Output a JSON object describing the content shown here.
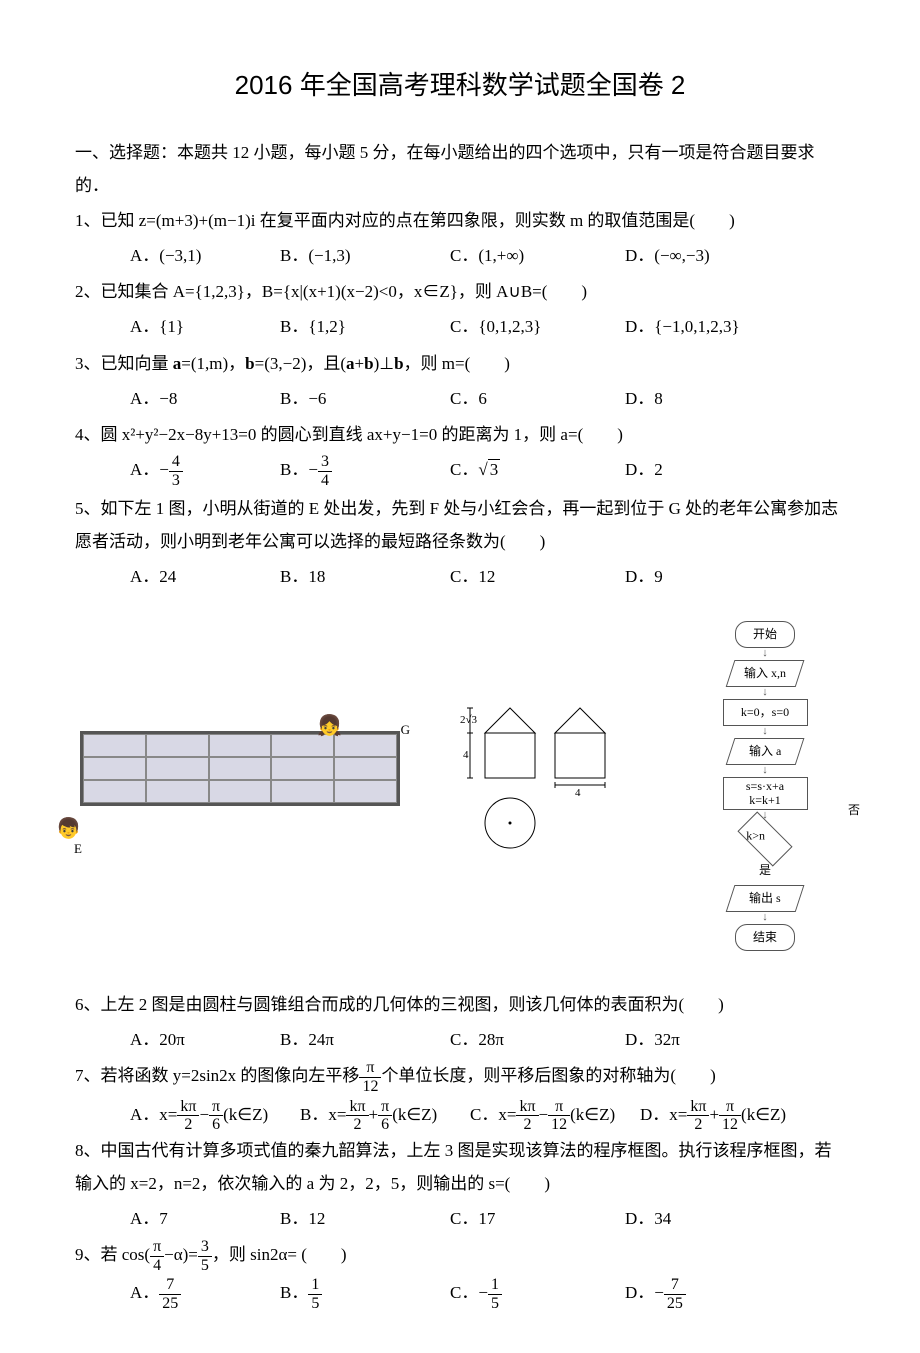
{
  "title": "2016 年全国高考理科数学试题全国卷 2",
  "section1": "一、选择题：本题共 12 小题，每小题 5 分，在每小题给出的四个选项中，只有一项是符合题目要求的．",
  "q1": {
    "text": "1、已知 z=(m+3)+(m−1)i 在复平面内对应的点在第四象限，则实数 m 的取值范围是(　　)",
    "a": "A．(−3,1)",
    "b": "B．(−1,3)",
    "c": "C．(1,+∞)",
    "d": "D．(−∞,−3)"
  },
  "q2": {
    "text": "2、已知集合 A={1,2,3}，B={x|(x+1)(x−2)<0，x∈Z}，则 A∪B=(　　)",
    "a": "A．{1}",
    "b": "B．{1,2}",
    "c": "C．{0,1,2,3}",
    "d": "D．{−1,0,1,2,3}"
  },
  "q3": {
    "text_pre": "3、已知向量 ",
    "a_vec": "a",
    "text_mid1": "=(1,m)，",
    "b_vec": "b",
    "text_mid2": "=(3,−2)，且(",
    "text_mid3": ")⊥",
    "text_end": "，则 m=(　　)",
    "a": "A．−8",
    "b": "B．−6",
    "c": "C．6",
    "d": "D．8"
  },
  "q4": {
    "text": "4、圆 x²+y²−2x−8y+13=0 的圆心到直线 ax+y−1=0 的距离为 1，则 a=(　　)",
    "a_pre": "A．−",
    "a_num": "4",
    "a_den": "3",
    "b_pre": "B．−",
    "b_num": "3",
    "b_den": "4",
    "c_pre": "C．",
    "c_val": "3",
    "d": "D．2"
  },
  "q5": {
    "text": "5、如下左 1 图，小明从街道的 E 处出发，先到 F 处与小红会合，再一起到位于 G 处的老年公寓参加志愿者活动，则小明到老年公寓可以选择的最短路径条数为(　　)",
    "a": "A．24",
    "b": "B．18",
    "c": "C．12",
    "d": "D．9"
  },
  "q6": {
    "text": "6、上左 2 图是由圆柱与圆锥组合而成的几何体的三视图，则该几何体的表面积为(　　)",
    "a": "A．20π",
    "b": "B．24π",
    "c": "C．28π",
    "d": "D．32π"
  },
  "q7": {
    "text_pre": "7、若将函数 y=2sin2x 的图像向左平移",
    "num": "π",
    "den": "12",
    "text_post": "个单位长度，则平移后图象的对称轴为(　　)",
    "a_pre": "A．x=",
    "a_n1": "kπ",
    "a_d1": "2",
    "a_mid": "−",
    "a_n2": "π",
    "a_d2": "6",
    "a_suf": "(k∈Z)",
    "b_pre": "B．x=",
    "b_mid": "+",
    "c_pre": "C．x=",
    "c_n2": "π",
    "c_d2": "12",
    "c_mid": "−",
    "d_pre": "D．x=",
    "d_mid": "+"
  },
  "q8": {
    "text": "8、中国古代有计算多项式值的秦九韶算法，上左 3 图是实现该算法的程序框图。执行该程序框图，若输入的 x=2，n=2，依次输入的 a 为 2，2，5，则输出的 s=(　　)",
    "a": "A．7",
    "b": "B．12",
    "c": "C．17",
    "d": "D．34"
  },
  "q9": {
    "text_pre": "9、若 cos(",
    "n1": "π",
    "d1": "4",
    "text_mid": "−α)=",
    "n2": "3",
    "d2": "5",
    "text_post": "，则 sin2α= (　　)",
    "a_pre": "A．",
    "a_num": "7",
    "a_den": "25",
    "b_pre": "B．",
    "b_num": "1",
    "b_den": "5",
    "c_pre": "C．−",
    "c_num": "1",
    "c_den": "5",
    "d_pre": "D．−",
    "d_num": "7",
    "d_den": "25"
  },
  "flowchart": {
    "start": "开始",
    "input1": "输入 x,n",
    "init": "k=0，s=0",
    "input2": "输入 a",
    "calc": "s=s·x+a\nk=k+1",
    "cond": "k>n",
    "no": "否",
    "yes": "是",
    "output": "输出 s",
    "end": "结束"
  },
  "fig2_labels": {
    "h1": "2√3",
    "h2": "4",
    "w": "4"
  }
}
